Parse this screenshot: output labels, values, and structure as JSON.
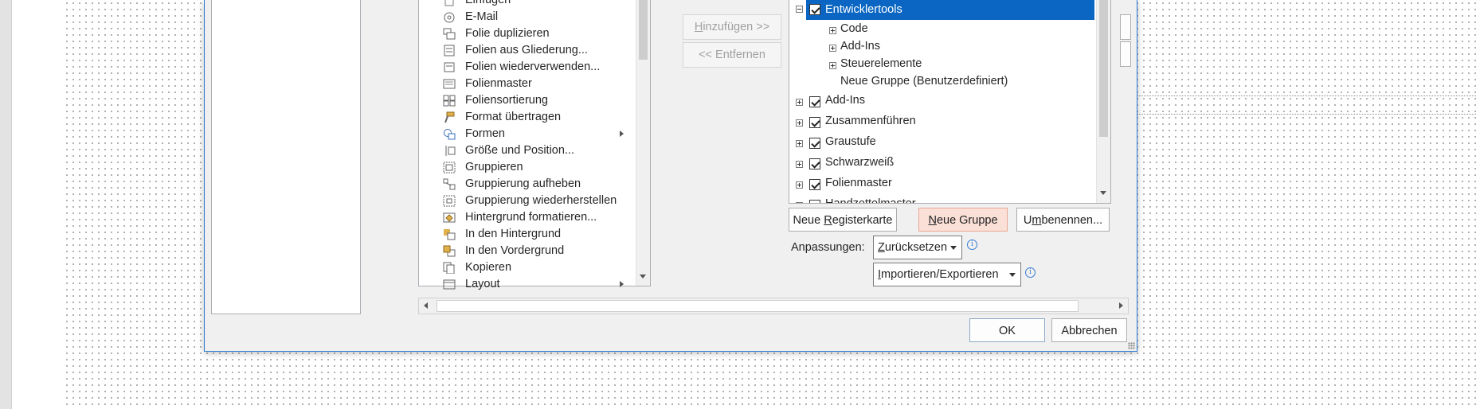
{
  "commands": [
    {
      "label": "Einfügen",
      "icon": "paste-icon"
    },
    {
      "label": "E-Mail",
      "icon": "email-icon"
    },
    {
      "label": "Folie duplizieren",
      "icon": "duplicate-slide-icon"
    },
    {
      "label": "Folien aus Gliederung...",
      "icon": "slides-from-outline-icon"
    },
    {
      "label": "Folien wiederverwenden...",
      "icon": "reuse-slides-icon"
    },
    {
      "label": "Folienmaster",
      "icon": "slide-master-icon"
    },
    {
      "label": "Foliensortierung",
      "icon": "slide-sorter-icon"
    },
    {
      "label": "Format übertragen",
      "icon": "format-painter-icon"
    },
    {
      "label": "Formen",
      "icon": "shapes-icon",
      "submenu": true
    },
    {
      "label": "Größe und Position...",
      "icon": "size-position-icon"
    },
    {
      "label": "Gruppieren",
      "icon": "group-icon"
    },
    {
      "label": "Gruppierung aufheben",
      "icon": "ungroup-icon"
    },
    {
      "label": "Gruppierung wiederherstellen",
      "icon": "regroup-icon"
    },
    {
      "label": "Hintergrund formatieren...",
      "icon": "format-background-icon"
    },
    {
      "label": "In den Hintergrund",
      "icon": "send-to-back-icon"
    },
    {
      "label": "In den Vordergrund",
      "icon": "bring-to-front-icon"
    },
    {
      "label": "Kopieren",
      "icon": "copy-icon"
    },
    {
      "label": "Layout",
      "icon": "layout-icon",
      "submenu": true
    }
  ],
  "add_label": "Hinzufügen >>",
  "remove_label": "<< Entfernen",
  "tree": {
    "selected": "Entwicklertools",
    "children": [
      "Code",
      "Add-Ins",
      "Steuerelemente"
    ],
    "custom_group": "Neue Gruppe (Benutzerdefiniert)",
    "tabs": [
      "Add-Ins",
      "Zusammenführen",
      "Graustufe",
      "Schwarzweiß",
      "Folienmaster",
      "Handzettelmaster"
    ]
  },
  "buttons": {
    "new_tab": {
      "pre": "Neue ",
      "u": "R",
      "post": "egisterkarte"
    },
    "new_group": {
      "pre": "",
      "u": "N",
      "post": "eue Gruppe"
    },
    "rename": {
      "pre": "U",
      "u": "m",
      "post": "benennen..."
    }
  },
  "customizations_label": "Anpassungen:",
  "reset_label": "Zurücksetzen",
  "import_export_label": "Importieren/Exportieren",
  "ok_label": "OK",
  "cancel_label": "Abbrechen",
  "colors": {
    "selection": "#0a66c2",
    "hover_button": "#fbe0d8",
    "dialog_border": "#2b79d0"
  }
}
